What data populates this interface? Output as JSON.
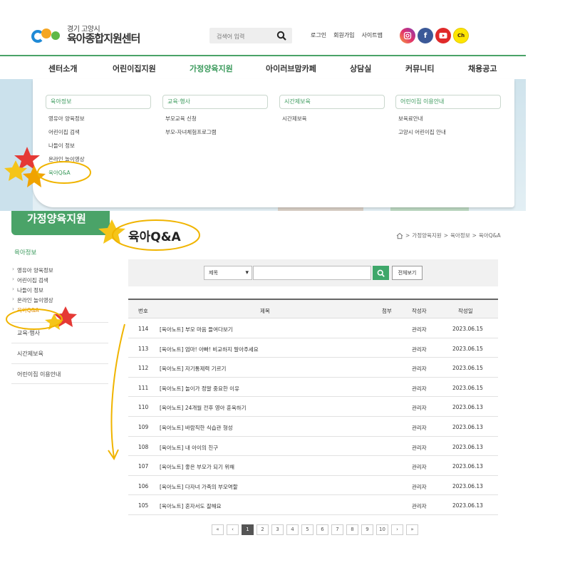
{
  "header": {
    "logo_small": "경기 고양시",
    "logo_big": "육아종합지원센터",
    "search_placeholder": "검색어 입력",
    "links": [
      "로그인",
      "회원가입",
      "사이트맵"
    ],
    "sns": {
      "kakao": "Ch"
    }
  },
  "gnb": [
    "센터소개",
    "어린이집지원",
    "가정양육지원",
    "아이러브맘카페",
    "상담실",
    "커뮤니티",
    "채용공고"
  ],
  "mega_menu": [
    {
      "title": "육아정보",
      "items": [
        "영유아 양육정보",
        "어린이집 검색",
        "나들이 정보",
        "온라인 놀이영상",
        "육아Q&A"
      ]
    },
    {
      "title": "교육·행사",
      "items": [
        "부모교육 신청",
        "부모-자녀체험프로그램"
      ]
    },
    {
      "title": "시간제보육",
      "items": [
        "시간제보육"
      ]
    },
    {
      "title": "어린이집 이용안내",
      "items": [
        "보육료안내",
        "고양시 어린이집 안내"
      ]
    }
  ],
  "sub_visual": {
    "section": "가정양육지원",
    "page_title": "육아Q&A"
  },
  "breadcrumb": [
    "가정양육지원",
    "육아정보",
    "육아Q&A"
  ],
  "lnb": {
    "head": "육아정보",
    "subs": [
      "영유아 양육정보",
      "어린이집 검색",
      "나들이 정보",
      "온라인 놀이영상",
      "육아Q&A"
    ],
    "mains": [
      "교육·행사",
      "시간제보육",
      "어린이집 이용안내"
    ]
  },
  "search": {
    "select_value": "제목",
    "all_button": "전체보기"
  },
  "board": {
    "columns": [
      "번호",
      "제목",
      "첨부",
      "작성자",
      "작성일"
    ],
    "rows": [
      {
        "num": "114",
        "title": "[육아노트] 부모 마음 들여다보기",
        "writer": "관리자",
        "date": "2023.06.15"
      },
      {
        "num": "113",
        "title": "[육아노트] 엄마! 아빠! 비교하지 말아주세요",
        "writer": "관리자",
        "date": "2023.06.15"
      },
      {
        "num": "112",
        "title": "[육아노트] 자기통제력 기르기",
        "writer": "관리자",
        "date": "2023.06.15"
      },
      {
        "num": "111",
        "title": "[육아노트] 놀이가 정말 중요한 이유",
        "writer": "관리자",
        "date": "2023.06.15"
      },
      {
        "num": "110",
        "title": "[육아노트] 24개월 전후 영아 훈육하기",
        "writer": "관리자",
        "date": "2023.06.13"
      },
      {
        "num": "109",
        "title": "[육아노트] 바람직한 식습관 형성",
        "writer": "관리자",
        "date": "2023.06.13"
      },
      {
        "num": "108",
        "title": "[육아노트] 내 아이의 친구",
        "writer": "관리자",
        "date": "2023.06.13"
      },
      {
        "num": "107",
        "title": "[육아노트] 좋은 부모가 되기 위해",
        "writer": "관리자",
        "date": "2023.06.13"
      },
      {
        "num": "106",
        "title": "[육아노트] 다자녀 가족의 부모역할",
        "writer": "관리자",
        "date": "2023.06.13"
      },
      {
        "num": "105",
        "title": "[육아노트] 혼자서도 잘해요",
        "writer": "관리자",
        "date": "2023.06.13"
      }
    ]
  },
  "pagination": {
    "first": "«",
    "prev": "‹",
    "pages": [
      "1",
      "2",
      "3",
      "4",
      "5",
      "6",
      "7",
      "8",
      "9",
      "10"
    ],
    "current": "1",
    "next": "›",
    "last": "»"
  },
  "colors": {
    "brand_green": "#4aa368",
    "highlight_orange": "#e08a00",
    "annotation_yellow": "#f0b400",
    "star_red": "#e53935"
  }
}
